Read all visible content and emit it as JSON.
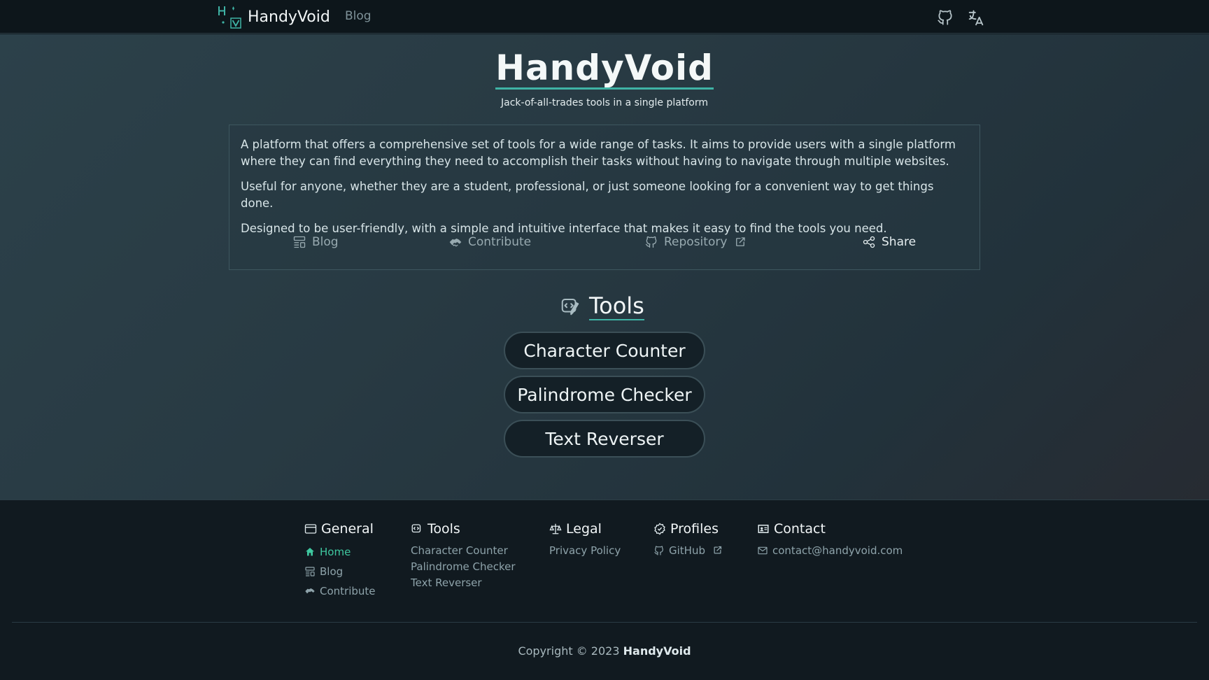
{
  "colors": {
    "accent": "#3fb3a5",
    "active_link": "#3fc8a0",
    "background_dark": "#111a20",
    "panel": "#2c414a"
  },
  "navbar": {
    "brand_name": "HandyVoid",
    "blog_label": "Blog",
    "logo_letters": "HV",
    "github_icon": "github-icon",
    "language_icon": "translate-icon"
  },
  "hero": {
    "title": "HandyVoid",
    "subtitle": "Jack-of-all-trades tools in a single platform"
  },
  "about": {
    "paragraphs": [
      "A platform that offers a comprehensive set of tools for a wide range of tasks. It aims to provide users with a single platform where they can find everything they need to accomplish their tasks without having to navigate through multiple websites.",
      "Useful for anyone, whether they are a student, professional, or just someone looking for a convenient way to get things done.",
      "Designed to be user-friendly, with a simple and intuitive interface that makes it easy to find the tools you need."
    ],
    "actions": {
      "blog": "Blog",
      "contribute": "Contribute",
      "repository": "Repository",
      "share": "Share"
    }
  },
  "tools": {
    "heading": "Tools",
    "items": [
      "Character Counter",
      "Palindrome Checker",
      "Text Reverser"
    ]
  },
  "footer": {
    "general": {
      "heading": "General",
      "links": [
        "Home",
        "Blog",
        "Contribute"
      ]
    },
    "tools": {
      "heading": "Tools",
      "links": [
        "Character Counter",
        "Palindrome Checker",
        "Text Reverser"
      ]
    },
    "legal": {
      "heading": "Legal",
      "links": [
        "Privacy Policy"
      ]
    },
    "profiles": {
      "heading": "Profiles",
      "links": [
        "GitHub"
      ]
    },
    "contact": {
      "heading": "Contact",
      "email": "contact@handyvoid.com"
    },
    "copyright_prefix": "Copyright © 2023",
    "copyright_brand": "HandyVoid"
  }
}
